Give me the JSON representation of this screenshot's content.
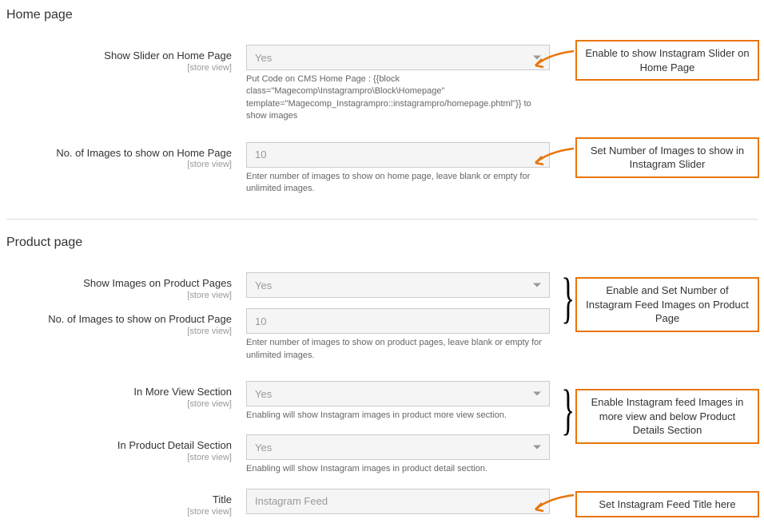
{
  "sections": {
    "home": {
      "title": "Home page",
      "fields": {
        "showSlider": {
          "label": "Show Slider on Home Page",
          "scope": "[store view]",
          "value": "Yes",
          "note": "Put Code on CMS Home Page : {{block class=\"Magecomp\\Instagrampro\\Block\\Homepage\" template=\"Magecomp_Instagrampro::instagrampro/homepage.phtml\"}} to show images"
        },
        "numImages": {
          "label": "No. of Images to show on Home Page",
          "scope": "[store view]",
          "value": "10",
          "note": "Enter number of images to show on home page, leave blank or empty for unlimited images."
        }
      }
    },
    "product": {
      "title": "Product page",
      "fields": {
        "showImages": {
          "label": "Show Images on Product Pages",
          "scope": "[store view]",
          "value": "Yes"
        },
        "numImages": {
          "label": "No. of Images to show on Product Page",
          "scope": "[store view]",
          "value": "10",
          "note": "Enter number of images to show on product pages, leave blank or empty for unlimited images."
        },
        "moreView": {
          "label": "In More View Section",
          "scope": "[store view]",
          "value": "Yes",
          "note": "Enabling will show Instagram images in product more view section."
        },
        "detailSection": {
          "label": "In Product Detail Section",
          "scope": "[store view]",
          "value": "Yes",
          "note": "Enabling will show Instagram images in product detail section."
        },
        "title": {
          "label": "Title",
          "scope": "[store view]",
          "value": "Instagram Feed"
        }
      }
    }
  },
  "callouts": {
    "c1": "Enable to show Instagram Slider on Home Page",
    "c2": "Set Number of Images to show in Instagram Slider",
    "c3": "Enable and Set Number of Instagram Feed Images on Product Page",
    "c4": "Enable Instagram feed Images in more view and below Product Details Section",
    "c5": "Set Instagram Feed Title here"
  }
}
